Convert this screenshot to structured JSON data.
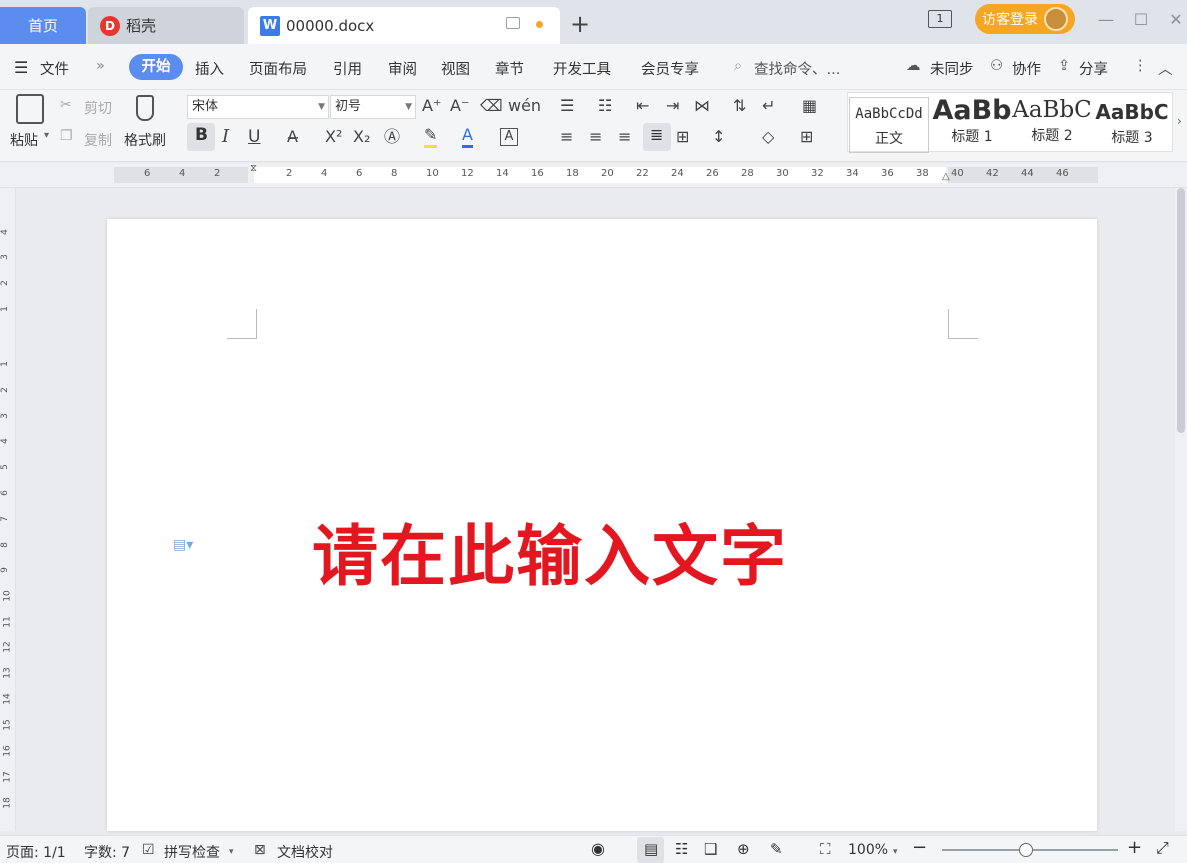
{
  "tabs": {
    "home": "首页",
    "daoke": "稻壳",
    "doc": "00000.docx",
    "new_tab": "+"
  },
  "titlebar": {
    "login": "访客登录",
    "page_indicator": "1"
  },
  "menubar": {
    "file": "文件",
    "items": [
      "开始",
      "插入",
      "页面布局",
      "引用",
      "审阅",
      "视图",
      "章节",
      "开发工具",
      "会员专享"
    ],
    "search": "查找命令、...",
    "unsync": "未同步",
    "collab": "协作",
    "share": "分享"
  },
  "ribbon": {
    "paste": "粘贴",
    "cut": "剪切",
    "copy": "复制",
    "format_painter": "格式刷",
    "font_name": "宋体",
    "font_size": "初号",
    "styles": [
      {
        "preview": "AaBbCcDd",
        "label": "正文"
      },
      {
        "preview": "AaBb",
        "label": "标题 1"
      },
      {
        "preview": "AaBbC",
        "label": "标题 2"
      },
      {
        "preview": "AaBbC",
        "label": "标题 3"
      }
    ]
  },
  "ruler": {
    "marks": [
      "6",
      "4",
      "2",
      "2",
      "4",
      "6",
      "8",
      "10",
      "12",
      "14",
      "16",
      "18",
      "20",
      "22",
      "24",
      "26",
      "28",
      "30",
      "32",
      "34",
      "36",
      "38",
      "40",
      "42",
      "44",
      "46"
    ],
    "vmarks": [
      "4",
      "3",
      "2",
      "1",
      "1",
      "2",
      "3",
      "4",
      "5",
      "6",
      "7",
      "8",
      "9",
      "10",
      "11",
      "12",
      "13",
      "14",
      "15",
      "16",
      "17",
      "18"
    ]
  },
  "document": {
    "text": "请在此输入文字"
  },
  "statusbar": {
    "page": "页面: 1/1",
    "words": "字数: 7",
    "spellcheck": "拼写检查",
    "proofread": "文档校对",
    "zoom": "100%"
  },
  "colors": {
    "accent": "#5b8def",
    "login": "#f5a623",
    "doc_text": "#e4161f"
  }
}
